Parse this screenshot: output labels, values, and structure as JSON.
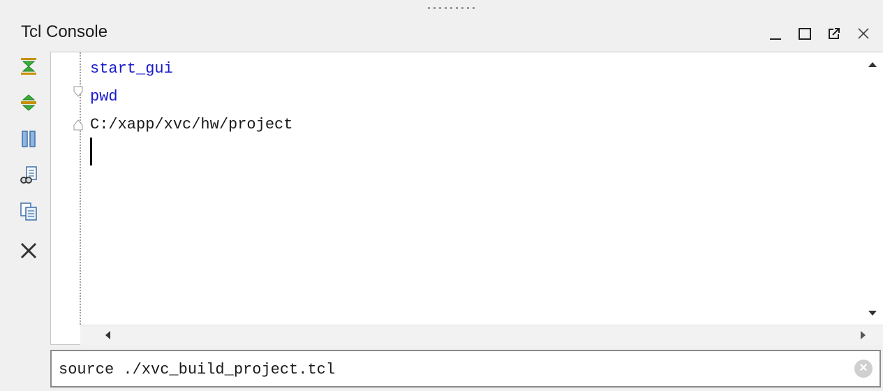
{
  "panel": {
    "title": "Tcl Console",
    "window_controls": [
      {
        "name": "minimize",
        "glyph": "_"
      },
      {
        "name": "maximize",
        "glyph": "☐"
      },
      {
        "name": "float",
        "glyph": "↗"
      },
      {
        "name": "close",
        "glyph": "✕"
      }
    ]
  },
  "toolbar": {
    "items": [
      {
        "name": "collapse-all-icon",
        "icon": "collapse-all"
      },
      {
        "name": "expand-all-icon",
        "icon": "expand-all"
      },
      {
        "name": "pause-icon",
        "icon": "pause"
      },
      {
        "name": "find-icon",
        "icon": "find"
      },
      {
        "name": "copy-icon",
        "icon": "copy"
      },
      {
        "name": "clear-icon",
        "icon": "clear"
      }
    ]
  },
  "console": {
    "lines": [
      {
        "text": "start_gui",
        "kind": "command"
      },
      {
        "text": "pwd",
        "kind": "command"
      },
      {
        "text": "C:/xapp/xvc/hw/project",
        "kind": "output"
      }
    ]
  },
  "input": {
    "value": "source ./xvc_build_project.tcl",
    "clear_glyph": "✕"
  },
  "colors": {
    "command_text": "#1a1acc",
    "output_text": "#1a1a1a",
    "background": "#f0f0f0"
  }
}
